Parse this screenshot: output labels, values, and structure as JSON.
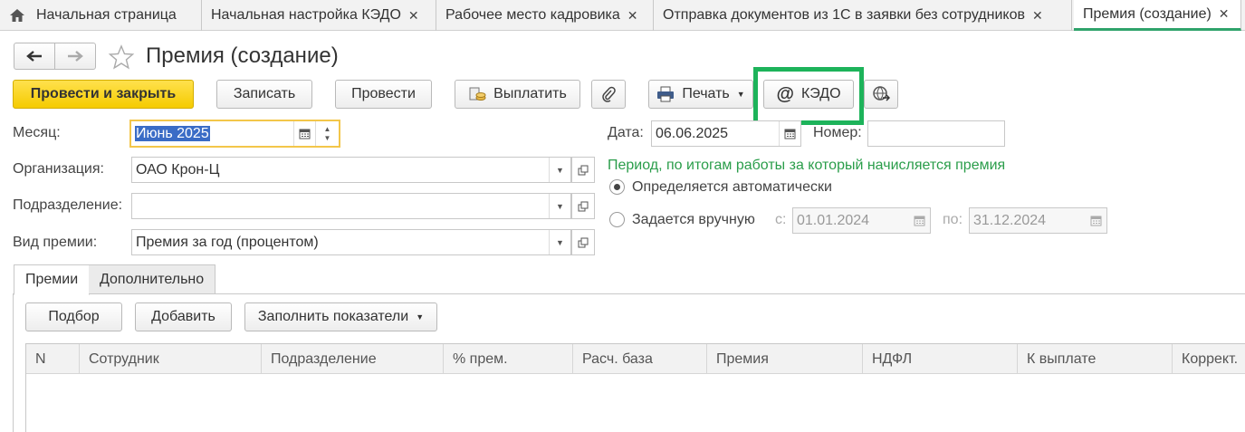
{
  "tabs": {
    "home": "Начальная страница",
    "items": [
      "Начальная настройка КЭДО",
      "Рабочее место кадровика",
      "Отправка документов из 1С в заявки без сотрудников",
      "Премия (создание)"
    ]
  },
  "title": "Премия (создание)",
  "toolbar": {
    "post_close": "Провести и закрыть",
    "save": "Записать",
    "post": "Провести",
    "pay": "Выплатить",
    "print": "Печать",
    "kedo": "КЭДО"
  },
  "form": {
    "month_label": "Месяц:",
    "month_value": "Июнь 2025",
    "org_label": "Организация:",
    "org_value": "ОАО Крон-Ц",
    "dept_label": "Подразделение:",
    "dept_value": "",
    "type_label": "Вид премии:",
    "type_value": "Премия за год (процентом)",
    "date_label": "Дата:",
    "date_value": "06.06.2025",
    "number_label": "Номер:",
    "number_value": "",
    "period_title": "Период, по итогам работы за который начисляется премия",
    "radio_auto": "Определяется автоматически",
    "radio_manual": "Задается вручную",
    "from_label": "с:",
    "from_value": "01.01.2024",
    "to_label": "по:",
    "to_value": "31.12.2024"
  },
  "sections": {
    "tab_bonuses": "Премии",
    "tab_additional": "Дополнительно",
    "pick": "Подбор",
    "add": "Добавить",
    "fill": "Заполнить показатели"
  },
  "table": {
    "columns": [
      "N",
      "Сотрудник",
      "Подразделение",
      "% прем.",
      "Расч. база",
      "Премия",
      "НДФЛ",
      "К выплате",
      "Коррект."
    ]
  },
  "colors": {
    "accent_green": "#1db35a",
    "primary_yellow": "#f5cb00",
    "period_green": "#2a9d4a",
    "selection_blue": "#3a6cc6"
  }
}
